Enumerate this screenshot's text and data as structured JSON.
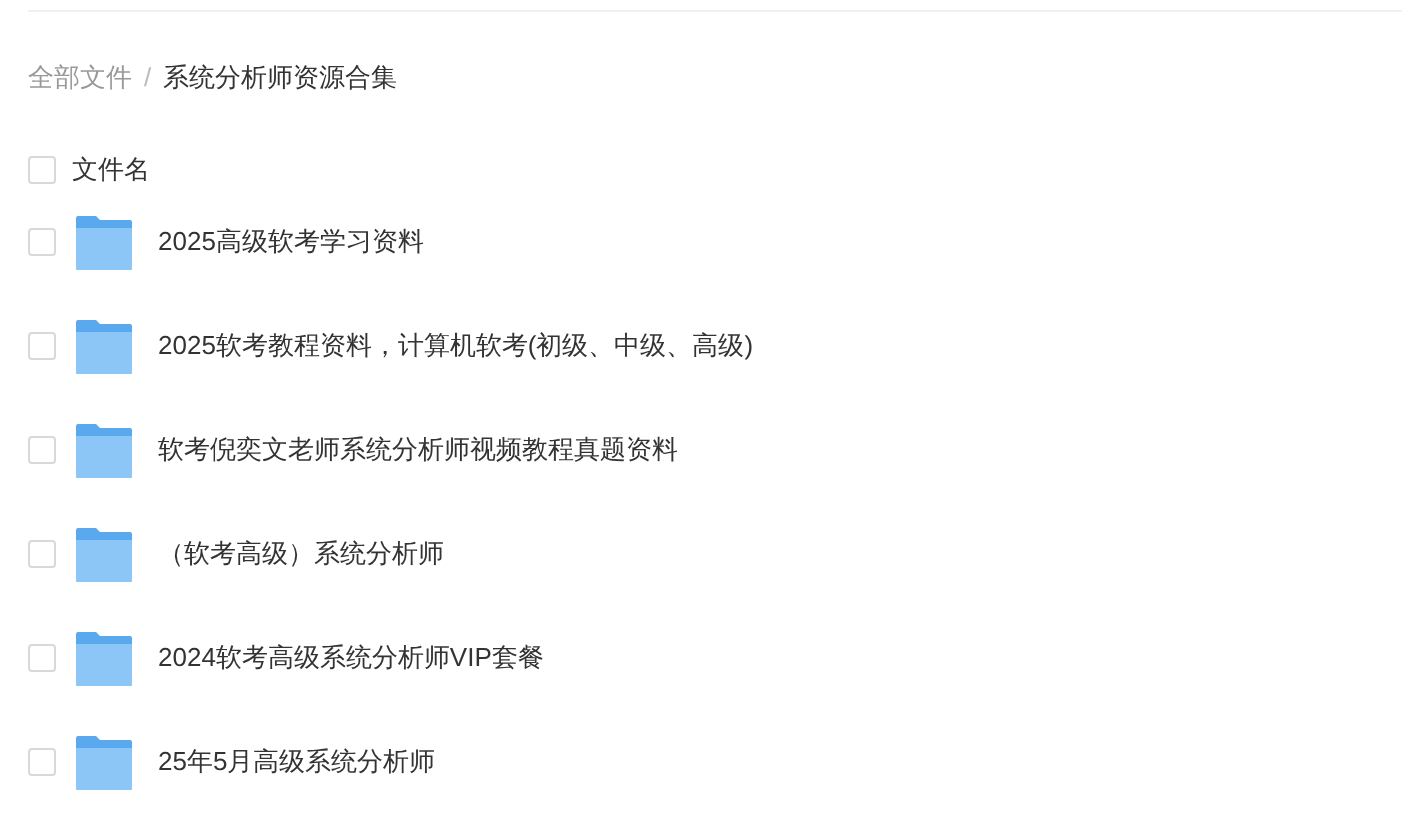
{
  "breadcrumb": [
    {
      "label": "全部文件",
      "current": false
    },
    {
      "label": "系统分析师资源合集",
      "current": true
    }
  ],
  "breadcrumb_separator": "/",
  "header": {
    "label": "文件名",
    "checked": false
  },
  "files": [
    {
      "name": "2025高级软考学习资料",
      "selected": false
    },
    {
      "name": "2025软考教程资料，计算机软考(初级、中级、高级)",
      "selected": false
    },
    {
      "name": "软考倪奕文老师系统分析师视频教程真题资料",
      "selected": false
    },
    {
      "name": "（软考高级）系统分析师",
      "selected": false
    },
    {
      "name": "2024软考高级系统分析师VIP套餐",
      "selected": false
    },
    {
      "name": "25年5月高级系统分析师",
      "selected": false
    }
  ]
}
